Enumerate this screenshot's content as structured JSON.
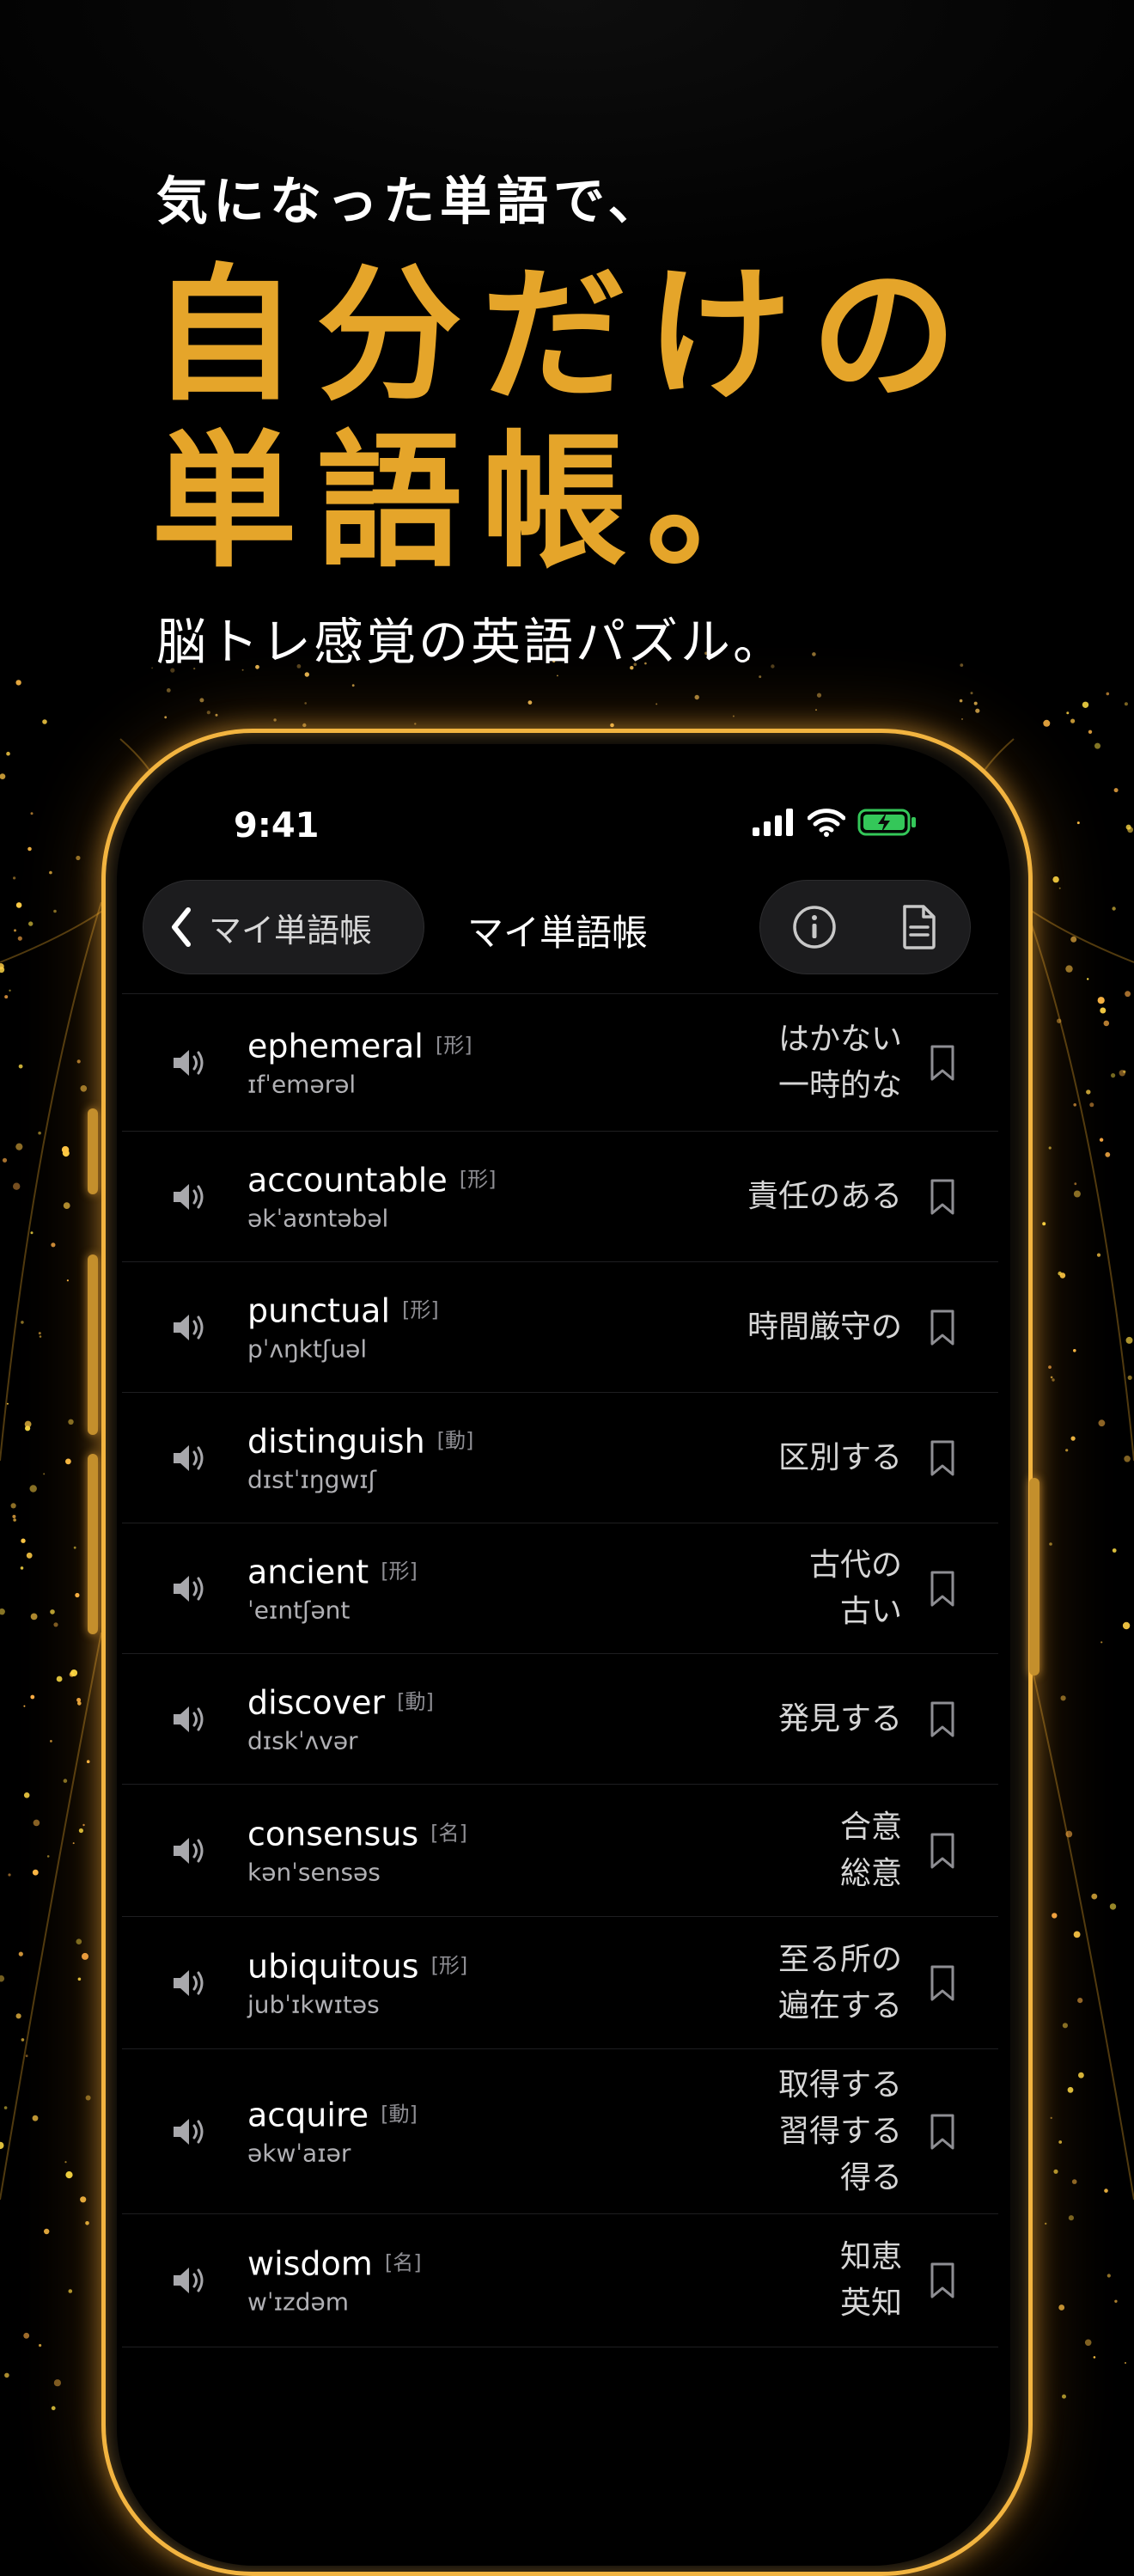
{
  "headline": {
    "sub": "気になった単語で、",
    "main_line1": "自分だけの",
    "main_line2": "単語帳。",
    "tagline": "脳トレ感覚の英語パズル。"
  },
  "status_bar": {
    "time": "9:41"
  },
  "nav": {
    "back_label": "マイ単語帳",
    "title": "マイ単語帳"
  },
  "colors": {
    "accent": "#e5a52a",
    "battery": "#34c759"
  },
  "words": [
    {
      "word": "ephemeral",
      "pos": "[形]",
      "ipa": "ɪfˈemərəl",
      "meaning": [
        "はかない",
        "一時的な"
      ]
    },
    {
      "word": "accountable",
      "pos": "[形]",
      "ipa": "əkˈaʊntəbəl",
      "meaning": [
        "責任のある"
      ]
    },
    {
      "word": "punctual",
      "pos": "[形]",
      "ipa": "pˈʌŋktʃuəl",
      "meaning": [
        "時間厳守の"
      ]
    },
    {
      "word": "distinguish",
      "pos": "[動]",
      "ipa": "dɪstˈɪŋgwɪʃ",
      "meaning": [
        "区別する"
      ]
    },
    {
      "word": "ancient",
      "pos": "[形]",
      "ipa": "ˈeɪntʃənt",
      "meaning": [
        "古代の",
        "古い"
      ]
    },
    {
      "word": "discover",
      "pos": "[動]",
      "ipa": "dɪskˈʌvər",
      "meaning": [
        "発見する"
      ]
    },
    {
      "word": "consensus",
      "pos": "[名]",
      "ipa": "kənˈsensəs",
      "meaning": [
        "合意",
        "総意"
      ]
    },
    {
      "word": "ubiquitous",
      "pos": "[形]",
      "ipa": "jubˈɪkwɪtəs",
      "meaning": [
        "至る所の",
        "遍在する"
      ]
    },
    {
      "word": "acquire",
      "pos": "[動]",
      "ipa": "əkwˈaɪər",
      "meaning": [
        "取得する",
        "習得する",
        "得る"
      ]
    },
    {
      "word": "wisdom",
      "pos": "[名]",
      "ipa": "wˈɪzdəm",
      "meaning": [
        "知恵",
        "英知"
      ]
    }
  ]
}
